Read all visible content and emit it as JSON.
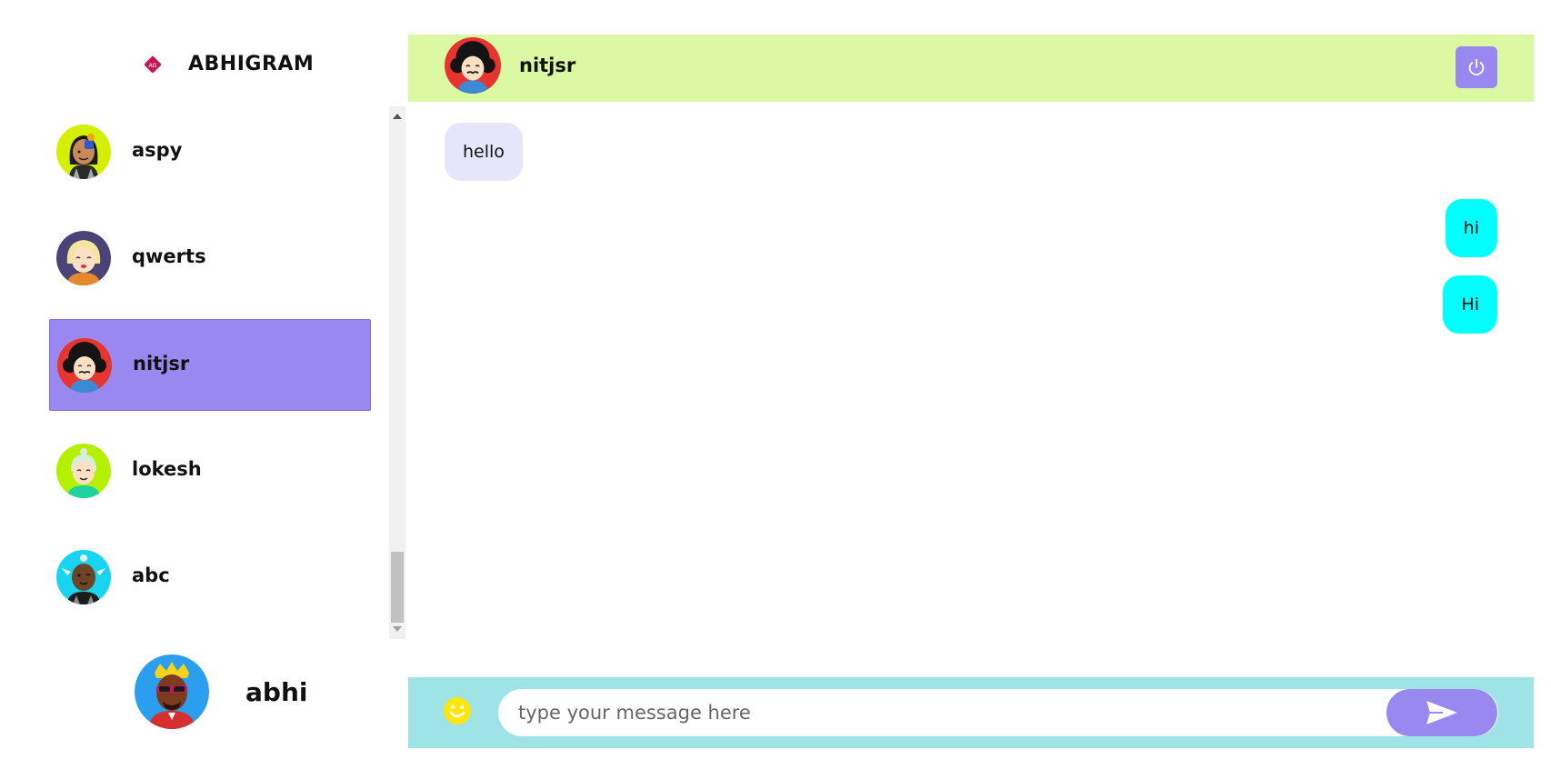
{
  "app": {
    "name": "ABHIGRAM"
  },
  "colors": {
    "accent": "#9988f0",
    "header_bg": "#dbf8a3",
    "composer_bg": "#9ee3e5",
    "incoming_bubble": "#e6e6fb",
    "outgoing_bubble": "#00ffff"
  },
  "contacts": [
    {
      "name": "aspy"
    },
    {
      "name": "qwerts"
    },
    {
      "name": "nitjsr"
    },
    {
      "name": "lokesh"
    },
    {
      "name": "abc"
    }
  ],
  "active_contact": "nitjsr",
  "current_user": {
    "name": "abhi"
  },
  "chat": {
    "partner_name": "nitjsr",
    "messages": [
      {
        "text": "hello",
        "direction": "incoming"
      },
      {
        "text": "hi",
        "direction": "outgoing"
      },
      {
        "text": "Hi",
        "direction": "outgoing"
      }
    ]
  },
  "composer": {
    "placeholder": "type your message here",
    "emoji_icon": "smiley-icon",
    "send_icon": "send-icon"
  },
  "header": {
    "logout_icon": "power-icon"
  }
}
